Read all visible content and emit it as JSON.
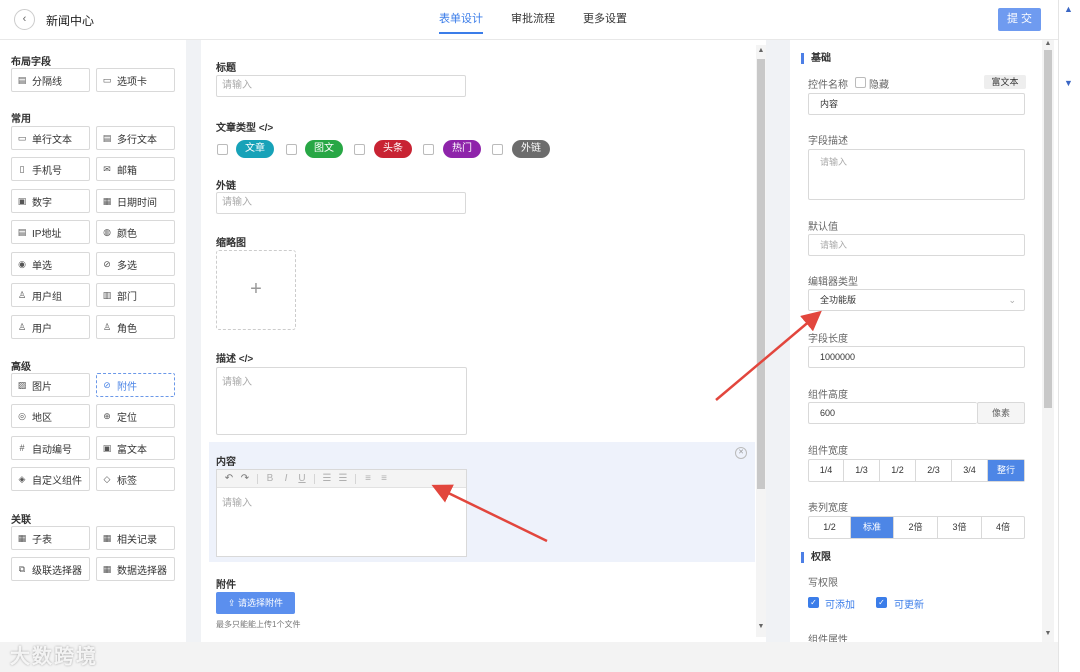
{
  "header": {
    "title": "新闻中心",
    "tabs": [
      {
        "label": "表单设计",
        "active": true
      },
      {
        "label": "审批流程",
        "active": false
      },
      {
        "label": "更多设置",
        "active": false
      }
    ],
    "submit_label": "提 交"
  },
  "left": {
    "groups": [
      {
        "title": "布局字段",
        "items": [
          {
            "label": "分隔线",
            "icon": "divider-icon"
          },
          {
            "label": "选项卡",
            "icon": "tabs-icon"
          }
        ]
      },
      {
        "title": "常用",
        "items": [
          {
            "label": "单行文本",
            "icon": "single-line-icon"
          },
          {
            "label": "多行文本",
            "icon": "multi-line-icon"
          },
          {
            "label": "手机号",
            "icon": "phone-icon"
          },
          {
            "label": "邮箱",
            "icon": "mail-icon"
          },
          {
            "label": "数字",
            "icon": "number-icon"
          },
          {
            "label": "日期时间",
            "icon": "calendar-icon"
          },
          {
            "label": "IP地址",
            "icon": "ip-icon"
          },
          {
            "label": "颜色",
            "icon": "palette-icon"
          },
          {
            "label": "单选",
            "icon": "radio-icon"
          },
          {
            "label": "多选",
            "icon": "check-circle-icon"
          },
          {
            "label": "用户组",
            "icon": "user-group-icon"
          },
          {
            "label": "部门",
            "icon": "department-icon"
          },
          {
            "label": "用户",
            "icon": "user-icon"
          },
          {
            "label": "角色",
            "icon": "role-icon"
          }
        ]
      },
      {
        "title": "高级",
        "items": [
          {
            "label": "图片",
            "icon": "image-icon"
          },
          {
            "label": "附件",
            "icon": "paperclip-icon"
          },
          {
            "label": "地区",
            "icon": "location-icon"
          },
          {
            "label": "定位",
            "icon": "crosshair-icon"
          },
          {
            "label": "自动编号",
            "icon": "hash-icon"
          },
          {
            "label": "富文本",
            "icon": "rich-text-icon"
          },
          {
            "label": "自定义组件",
            "icon": "component-icon"
          },
          {
            "label": "标签",
            "icon": "tag-icon"
          }
        ]
      },
      {
        "title": "关联",
        "items": [
          {
            "label": "子表",
            "icon": "table-icon"
          },
          {
            "label": "相关记录",
            "icon": "records-icon"
          },
          {
            "label": "级联选择器",
            "icon": "cascader-icon"
          },
          {
            "label": "数据选择器",
            "icon": "data-picker-icon"
          }
        ]
      }
    ]
  },
  "center": {
    "title_label": "标题",
    "title_placeholder": "请输入",
    "type_label": "文章类型",
    "code_glyph": "</>",
    "tags": [
      {
        "label": "文章",
        "color": "#17a2b8"
      },
      {
        "label": "图文",
        "color": "#28a745"
      },
      {
        "label": "头条",
        "color": "#c82333"
      },
      {
        "label": "热门",
        "color": "#8e24aa"
      },
      {
        "label": "外链",
        "color": "#6c6c6c"
      }
    ],
    "link_label": "外链",
    "link_placeholder": "请输入",
    "thumb_label": "缩略图",
    "thumb_plus": "+",
    "desc_label": "描述",
    "desc_placeholder": "请输入",
    "content_label": "内容",
    "content_placeholder": "请输入",
    "attach_label": "附件",
    "upload_label": "请选择附件",
    "upload_hint": "最多只能能上传1个文件"
  },
  "right": {
    "basic_title": "基础",
    "name_label": "控件名称",
    "hide_label": "隐藏",
    "richtext_badge": "富文本",
    "name_value": "内容",
    "desc_label": "字段描述",
    "desc_placeholder": "请输入",
    "default_label": "默认值",
    "default_placeholder": "请输入",
    "editor_type_label": "编辑器类型",
    "editor_type_value": "全功能版",
    "length_label": "字段长度",
    "length_value": "1000000",
    "height_label": "组件高度",
    "height_value": "600",
    "height_unit": "像素",
    "width_label": "组件宽度",
    "width_options": [
      "1/4",
      "1/3",
      "1/2",
      "2/3",
      "3/4",
      "整行"
    ],
    "width_active": "整行",
    "col_width_label": "表列宽度",
    "col_width_options": [
      "1/2",
      "标准",
      "2倍",
      "3倍",
      "4倍"
    ],
    "col_width_active": "标准",
    "perm_title": "权限",
    "write_label": "写权限",
    "can_add": "可添加",
    "can_update": "可更新",
    "attr_label": "组件属性"
  },
  "watermark": "大数跨境"
}
